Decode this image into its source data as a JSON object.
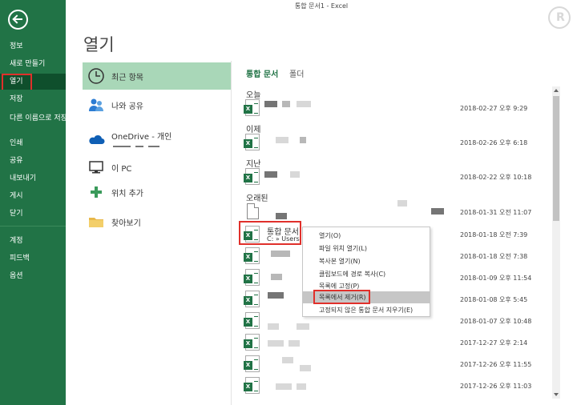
{
  "window": {
    "title": "통합 문서1 - Excel"
  },
  "nav": {
    "items": [
      {
        "label": "정보",
        "name": "nav-info"
      },
      {
        "label": "새로 만들기",
        "name": "nav-new"
      },
      {
        "label": "열기",
        "name": "nav-open",
        "active": true
      },
      {
        "label": "저장",
        "name": "nav-save"
      },
      {
        "label": "다른 이름으로 저장",
        "name": "nav-save-as"
      },
      {
        "label": "인쇄",
        "name": "nav-print"
      },
      {
        "label": "공유",
        "name": "nav-share"
      },
      {
        "label": "내보내기",
        "name": "nav-export"
      },
      {
        "label": "게시",
        "name": "nav-publish"
      },
      {
        "label": "닫기",
        "name": "nav-close"
      },
      {
        "label": "계정",
        "name": "nav-account"
      },
      {
        "label": "피드백",
        "name": "nav-feedback"
      },
      {
        "label": "옵션",
        "name": "nav-options"
      }
    ]
  },
  "page_title": "열기",
  "places": [
    {
      "label": "최근 항목",
      "icon": "clock-icon",
      "active": true
    },
    {
      "label": "나와 공유",
      "icon": "people-icon"
    },
    {
      "label": "OneDrive - 개인",
      "icon": "cloud-icon"
    },
    {
      "label": "이 PC",
      "icon": "computer-icon"
    },
    {
      "label": "위치 추가",
      "icon": "plus-icon"
    },
    {
      "label": "찾아보기",
      "icon": "folder-icon"
    }
  ],
  "tabs": {
    "workbooks": "통합 문서",
    "folders": "폴더"
  },
  "groups": {
    "today": "오늘",
    "yesterday": "이제",
    "last_week": "지난",
    "older": "오래된"
  },
  "files": [
    {
      "date": "2018-02-27 오후 9:29"
    },
    {
      "date": "2018-02-26 오후 6:18"
    },
    {
      "date": "2018-02-22 오후 10:18"
    },
    {
      "date": "2018-01-31 오전 11:07"
    },
    {
      "date": "2018-01-18 오전 7:39",
      "name": "통합 문서",
      "path": "C: » Users »"
    },
    {
      "date": "2018-01-18 오전 7:38"
    },
    {
      "date": "2018-01-09 오후 11:54"
    },
    {
      "date": "2018-01-08 오후 5:45"
    },
    {
      "date": "2018-01-07 오후 10:48"
    },
    {
      "date": "2017-12-27 오후 2:14"
    },
    {
      "date": "2017-12-26 오후 11:55"
    },
    {
      "date": "2017-12-26 오후 11:03"
    }
  ],
  "context_menu": {
    "items": [
      "열기(O)",
      "파일 위치 열기(L)",
      "복사본 열기(N)",
      "클립보드에 경로 복사(C)",
      "목록에 고정(P)",
      "목록에서 제거(R)",
      "고정되지 않은 통합 문서 지우기(E)"
    ],
    "hovered_index": 5
  },
  "colors": {
    "accent": "#217346",
    "active_place": "#a9d7b8",
    "highlight": "#e0302b"
  }
}
